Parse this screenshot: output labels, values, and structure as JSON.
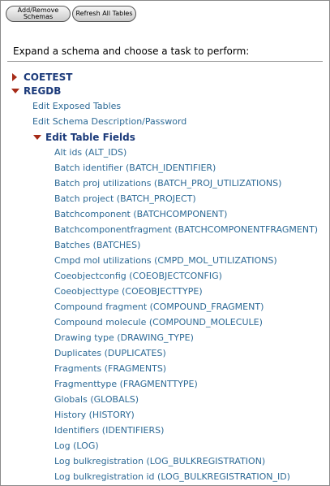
{
  "toolbar": {
    "add_remove_line1": "Add/Remove",
    "add_remove_line2": "Schemas",
    "refresh_label": "Refresh All Tables"
  },
  "intro_text": "Expand a schema and choose a task to perform:",
  "schemas": [
    {
      "name": "COETEST",
      "expanded": false
    },
    {
      "name": "REGDB",
      "expanded": true
    }
  ],
  "regdb_tasks": [
    "Edit Exposed Tables",
    "Edit Schema Description/Password"
  ],
  "edit_table_fields_label": "Edit Table Fields",
  "tables": [
    "Alt ids (ALT_IDS)",
    "Batch identifier (BATCH_IDENTIFIER)",
    "Batch proj utilizations (BATCH_PROJ_UTILIZATIONS)",
    "Batch project (BATCH_PROJECT)",
    "Batchcomponent (BATCHCOMPONENT)",
    "Batchcomponentfragment (BATCHCOMPONENTFRAGMENT)",
    "Batches (BATCHES)",
    "Cmpd mol utilizations (CMPD_MOL_UTILIZATIONS)",
    "Coeobjectconfig (COEOBJECTCONFIG)",
    "Coeobjecttype (COEOBJECTTYPE)",
    "Compound fragment (COMPOUND_FRAGMENT)",
    "Compound molecule (COMPOUND_MOLECULE)",
    "Drawing type (DRAWING_TYPE)",
    "Duplicates (DUPLICATES)",
    "Fragments (FRAGMENTS)",
    "Fragmenttype (FRAGMENTTYPE)",
    "Globals (GLOBALS)",
    "History (HISTORY)",
    "Identifiers (IDENTIFIERS)",
    "Log (LOG)",
    "Log bulkregistration (LOG_BULKREGISTRATION)",
    "Log bulkregistration id (LOG_BULKREGISTRATION_ID)"
  ],
  "colors": {
    "link": "#2d6a96",
    "schema_heading": "#1b3a7a",
    "expand_arrow": "#a62a17"
  },
  "icons": {
    "collapsed": "triangle-right-icon",
    "expanded": "triangle-down-icon"
  }
}
